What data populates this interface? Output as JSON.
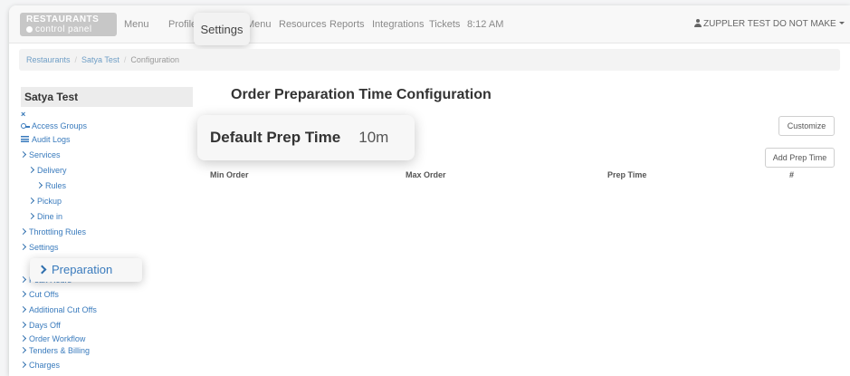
{
  "brand": {
    "line1": "RESTAURANTS",
    "line2": "control panel"
  },
  "nav": {
    "items": [
      "Menu",
      "Profile",
      "Menu",
      "Resources",
      "Reports",
      "Integrations",
      "Tickets"
    ],
    "highlighted": "Settings",
    "time": "8:12 AM",
    "user": "ZUPPLER TEST DO NOT MAKE"
  },
  "breadcrumb": [
    "Restaurants",
    "Satya Test",
    "Configuration"
  ],
  "sidebar": {
    "title": "Satya Test",
    "close": "×",
    "items": [
      {
        "label": "Access Groups",
        "icon": "key-icon"
      },
      {
        "label": "Audit Logs",
        "icon": "list-icon"
      },
      {
        "label": "Services",
        "icon": "chevron-right-icon"
      },
      {
        "label": "Delivery",
        "icon": "chevron-right-icon"
      },
      {
        "label": "Rules",
        "icon": "chevron-right-icon"
      },
      {
        "label": "Pickup",
        "icon": "chevron-right-icon"
      },
      {
        "label": "Dine in",
        "icon": "chevron-right-icon"
      },
      {
        "label": "Throttling Rules",
        "icon": "chevron-right-icon"
      },
      {
        "label": "Settings",
        "icon": "chevron-right-icon"
      },
      {
        "label": "Preparation",
        "icon": "chevron-right-icon"
      },
      {
        "label": "Peak Hours",
        "icon": "chevron-right-icon"
      },
      {
        "label": "Cut Offs",
        "icon": "chevron-right-icon"
      },
      {
        "label": "Additional Cut Offs",
        "icon": "chevron-right-icon"
      },
      {
        "label": "Days Off",
        "icon": "chevron-right-icon"
      },
      {
        "label": "Order Workflow",
        "icon": "chevron-right-icon"
      },
      {
        "label": "Tenders & Billing",
        "icon": "chevron-right-icon"
      },
      {
        "label": "Charges",
        "icon": "chevron-right-icon"
      }
    ]
  },
  "main": {
    "title": "Order Preparation Time Configuration",
    "default_prep_label": "Default Prep Time",
    "default_prep_value": "10m",
    "customize_label": "Customize",
    "add_prep_label": "Add Prep Time",
    "columns": [
      "Min Order",
      "Max Order",
      "Prep Time",
      "#"
    ]
  },
  "colors": {
    "link": "#3a7bbd",
    "brand_bg": "#c7c7c7"
  }
}
